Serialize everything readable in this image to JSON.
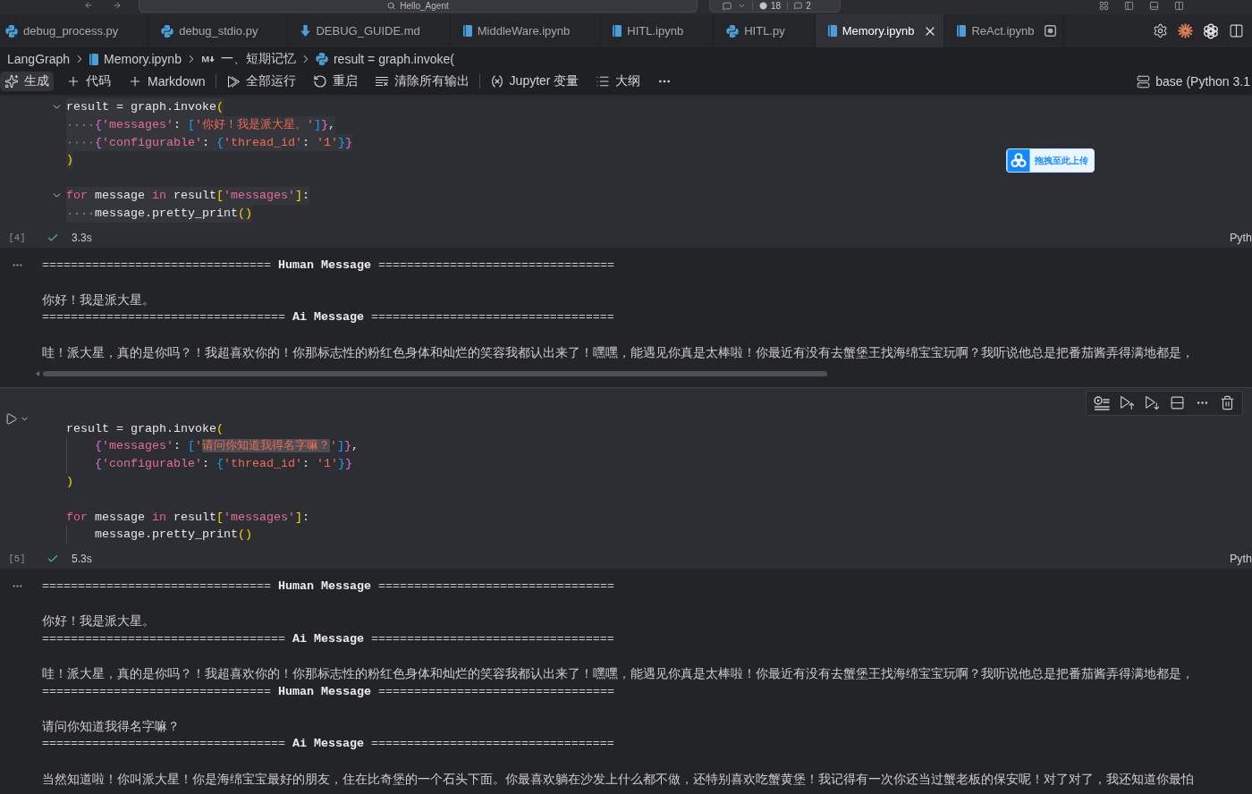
{
  "title_bar": {
    "command_center": {
      "label": "Hello_Agent"
    },
    "counters": [
      {
        "kind": "problems",
        "label": "18"
      },
      {
        "kind": "comments",
        "label": "2"
      }
    ]
  },
  "tabs": [
    {
      "label": "debug_process.py",
      "kind": "python",
      "selected": false,
      "modified": false
    },
    {
      "label": "debug_stdio.py",
      "kind": "python",
      "selected": false,
      "modified": false
    },
    {
      "label": "DEBUG_GUIDE.md",
      "kind": "markdown",
      "selected": false,
      "modified": false
    },
    {
      "label": "MiddleWare.ipynb",
      "kind": "notebook",
      "selected": false,
      "modified": false
    },
    {
      "label": "HITL.ipynb",
      "kind": "notebook",
      "selected": false,
      "modified": false
    },
    {
      "label": "HITL.py",
      "kind": "python",
      "selected": false,
      "modified": false
    },
    {
      "label": "Memory.ipynb",
      "kind": "notebook",
      "selected": true,
      "modified": false
    },
    {
      "label": "ReAct.ipynb",
      "kind": "notebook",
      "selected": false,
      "modified": true
    }
  ],
  "breadcrumbs": [
    {
      "label": "LangGraph",
      "kind": "folder"
    },
    {
      "label": "Memory.ipynb",
      "kind": "notebook"
    },
    {
      "label": "一、短期记忆",
      "kind": "markdown"
    },
    {
      "label": "result = graph.invoke(",
      "kind": "python"
    }
  ],
  "toolbar": {
    "groups": [
      {
        "items": [
          {
            "kind": "generate",
            "label": "生成",
            "hovered": true
          },
          {
            "kind": "add",
            "label": "代码",
            "hovered": false
          },
          {
            "kind": "add",
            "label": "Markdown",
            "hovered": false
          }
        ]
      },
      {
        "items": [
          {
            "kind": "run_all",
            "label": "全部运行",
            "hovered": false
          },
          {
            "kind": "restart",
            "label": "重启",
            "hovered": false
          },
          {
            "kind": "clear",
            "label": "清除所有输出",
            "hovered": false
          }
        ]
      },
      {
        "items": [
          {
            "kind": "variables",
            "label": "Jupyter 变量",
            "hovered": false
          },
          {
            "kind": "outline",
            "label": "大纲",
            "hovered": false
          },
          {
            "kind": "more",
            "hovered": false
          }
        ]
      }
    ],
    "kernel": {
      "label": "base (Python 3.1"
    }
  },
  "drop_badge": {
    "label": "拖拽至此上传"
  },
  "cells": [
    {
      "selected": false,
      "text_selected": true,
      "execution_count": "[4]",
      "succeeded": true,
      "duration": "3.3s",
      "language": "Pyth",
      "lines": [
        {
          "kind": "code",
          "indented": false,
          "fold_marker": true,
          "tokens": [
            {
              "kind": "plain",
              "text": "result = graph.invoke"
            },
            {
              "kind": "bracket1",
              "text": "("
            }
          ]
        },
        {
          "kind": "code",
          "indented": true,
          "fold_marker": false,
          "tokens": [
            {
              "kind": "bracket2",
              "text": "{"
            },
            {
              "kind": "key",
              "text": "'messages'"
            },
            {
              "kind": "plain",
              "text": ": "
            },
            {
              "kind": "bracket3",
              "text": "["
            },
            {
              "kind": "string",
              "text": "'你好！我是派大星。'"
            },
            {
              "kind": "bracket3",
              "text": "]"
            },
            {
              "kind": "bracket2",
              "text": "}"
            },
            {
              "kind": "plain",
              "text": ","
            }
          ]
        },
        {
          "kind": "code",
          "indented": true,
          "fold_marker": false,
          "tokens": [
            {
              "kind": "bracket2",
              "text": "{"
            },
            {
              "kind": "key",
              "text": "'configurable'"
            },
            {
              "kind": "plain",
              "text": ": "
            },
            {
              "kind": "bracket3",
              "text": "{"
            },
            {
              "kind": "string",
              "text": "'thread_id'"
            },
            {
              "kind": "plain",
              "text": ": "
            },
            {
              "kind": "string",
              "text": "'1'"
            },
            {
              "kind": "bracket3",
              "text": "}"
            },
            {
              "kind": "bracket2",
              "text": "}"
            }
          ]
        },
        {
          "kind": "code",
          "indented": false,
          "fold_marker": false,
          "tokens": [
            {
              "kind": "bracket1",
              "text": ")"
            }
          ]
        },
        {
          "kind": "blank",
          "indented": false,
          "fold_marker": false
        },
        {
          "kind": "code",
          "indented": false,
          "fold_marker": true,
          "tokens": [
            {
              "kind": "keyword",
              "text": "for"
            },
            {
              "kind": "plain",
              "text": " message "
            },
            {
              "kind": "keyword",
              "text": "in"
            },
            {
              "kind": "plain",
              "text": " result"
            },
            {
              "kind": "bracket1",
              "text": "["
            },
            {
              "kind": "key",
              "text": "'messages'"
            },
            {
              "kind": "bracket1",
              "text": "]"
            },
            {
              "kind": "plain",
              "text": ":"
            }
          ]
        },
        {
          "kind": "code",
          "indented": true,
          "fold_marker": false,
          "tokens": [
            {
              "kind": "plain",
              "text": "message.pretty_print"
            },
            {
              "kind": "bracket1",
              "text": "()"
            }
          ]
        }
      ],
      "output": {
        "scrollbar": true,
        "lines": [
          {
            "kind": "header",
            "text": "================================ **Human Message** ================================="
          },
          {
            "kind": "blank"
          },
          {
            "kind": "text",
            "text": "你好！我是派大星。"
          },
          {
            "kind": "header",
            "text": "================================== **Ai Message** =================================="
          },
          {
            "kind": "blank"
          },
          {
            "kind": "text",
            "text": "哇！派大星，真的是你吗？！我超喜欢你的！你那标志性的粉红色身体和灿烂的笑容我都认出来了！嘿嘿，能遇见你真是太棒啦！你最近有没有去蟹堡王找海绵宝宝玩啊？我听说他总是把番茄酱弄得满地都是，"
          }
        ]
      }
    },
    {
      "selected": true,
      "text_selected": false,
      "execution_count": "[5]",
      "succeeded": true,
      "duration": "5.3s",
      "language": "Pyth",
      "lines": [
        {
          "kind": "code",
          "indented": false,
          "fold_marker": false,
          "tokens": [
            {
              "kind": "plain",
              "text": "result = graph.invoke"
            },
            {
              "kind": "bracket1",
              "text": "("
            }
          ]
        },
        {
          "kind": "code",
          "indented": true,
          "fold_marker": false,
          "tokens": [
            {
              "kind": "bracket2",
              "text": "{"
            },
            {
              "kind": "key",
              "text": "'messages'"
            },
            {
              "kind": "plain",
              "text": ": "
            },
            {
              "kind": "bracket3",
              "text": "["
            },
            {
              "kind": "string",
              "text": "'"
            },
            {
              "kind": "match",
              "text": "请问你知道我得名字嘛？"
            },
            {
              "kind": "string",
              "text": "'"
            },
            {
              "kind": "bracket3",
              "text": "]"
            },
            {
              "kind": "bracket2",
              "text": "}"
            },
            {
              "kind": "plain",
              "text": ","
            }
          ]
        },
        {
          "kind": "code",
          "indented": true,
          "fold_marker": false,
          "tokens": [
            {
              "kind": "bracket2",
              "text": "{"
            },
            {
              "kind": "key",
              "text": "'configurable'"
            },
            {
              "kind": "plain",
              "text": ": "
            },
            {
              "kind": "bracket3",
              "text": "{"
            },
            {
              "kind": "string",
              "text": "'thread_id'"
            },
            {
              "kind": "plain",
              "text": ": "
            },
            {
              "kind": "string",
              "text": "'1'"
            },
            {
              "kind": "bracket3",
              "text": "}"
            },
            {
              "kind": "bracket2",
              "text": "}"
            }
          ]
        },
        {
          "kind": "code",
          "indented": false,
          "fold_marker": false,
          "tokens": [
            {
              "kind": "bracket1",
              "text": ")"
            }
          ]
        },
        {
          "kind": "blank",
          "indented": false,
          "fold_marker": false
        },
        {
          "kind": "code",
          "indented": false,
          "fold_marker": false,
          "tokens": [
            {
              "kind": "keyword",
              "text": "for"
            },
            {
              "kind": "plain",
              "text": " message "
            },
            {
              "kind": "keyword",
              "text": "in"
            },
            {
              "kind": "plain",
              "text": " result"
            },
            {
              "kind": "bracket1",
              "text": "["
            },
            {
              "kind": "key",
              "text": "'messages'"
            },
            {
              "kind": "bracket1",
              "text": "]"
            },
            {
              "kind": "plain",
              "text": ":"
            }
          ]
        },
        {
          "kind": "code",
          "indented": true,
          "fold_marker": false,
          "tokens": [
            {
              "kind": "plain",
              "text": "message.pretty_print"
            },
            {
              "kind": "bracket1",
              "text": "()"
            }
          ]
        }
      ],
      "output": {
        "scrollbar": false,
        "lines": [
          {
            "kind": "header",
            "text": "================================ **Human Message** ================================="
          },
          {
            "kind": "blank"
          },
          {
            "kind": "text",
            "text": "你好！我是派大星。"
          },
          {
            "kind": "header",
            "text": "================================== **Ai Message** =================================="
          },
          {
            "kind": "blank"
          },
          {
            "kind": "text",
            "text": "哇！派大星，真的是你吗？！我超喜欢你的！你那标志性的粉红色身体和灿烂的笑容我都认出来了！嘿嘿，能遇见你真是太棒啦！你最近有没有去蟹堡王找海绵宝宝玩啊？我听说他总是把番茄酱弄得满地都是，"
          },
          {
            "kind": "header",
            "text": "================================ **Human Message** ================================="
          },
          {
            "kind": "blank"
          },
          {
            "kind": "text",
            "text": "请问你知道我得名字嘛？"
          },
          {
            "kind": "header",
            "text": "================================== **Ai Message** =================================="
          },
          {
            "kind": "blank"
          },
          {
            "kind": "text",
            "text": "当然知道啦！你叫派大星！你是海绵宝宝最好的朋友，住在比奇堡的一个石头下面。你最喜欢躺在沙发上什么都不做，还特别喜欢吃蟹黄堡！我记得有一次你还当过蟹老板的保安呢！对了对了，我还知道你最怕"
          }
        ]
      }
    }
  ]
}
